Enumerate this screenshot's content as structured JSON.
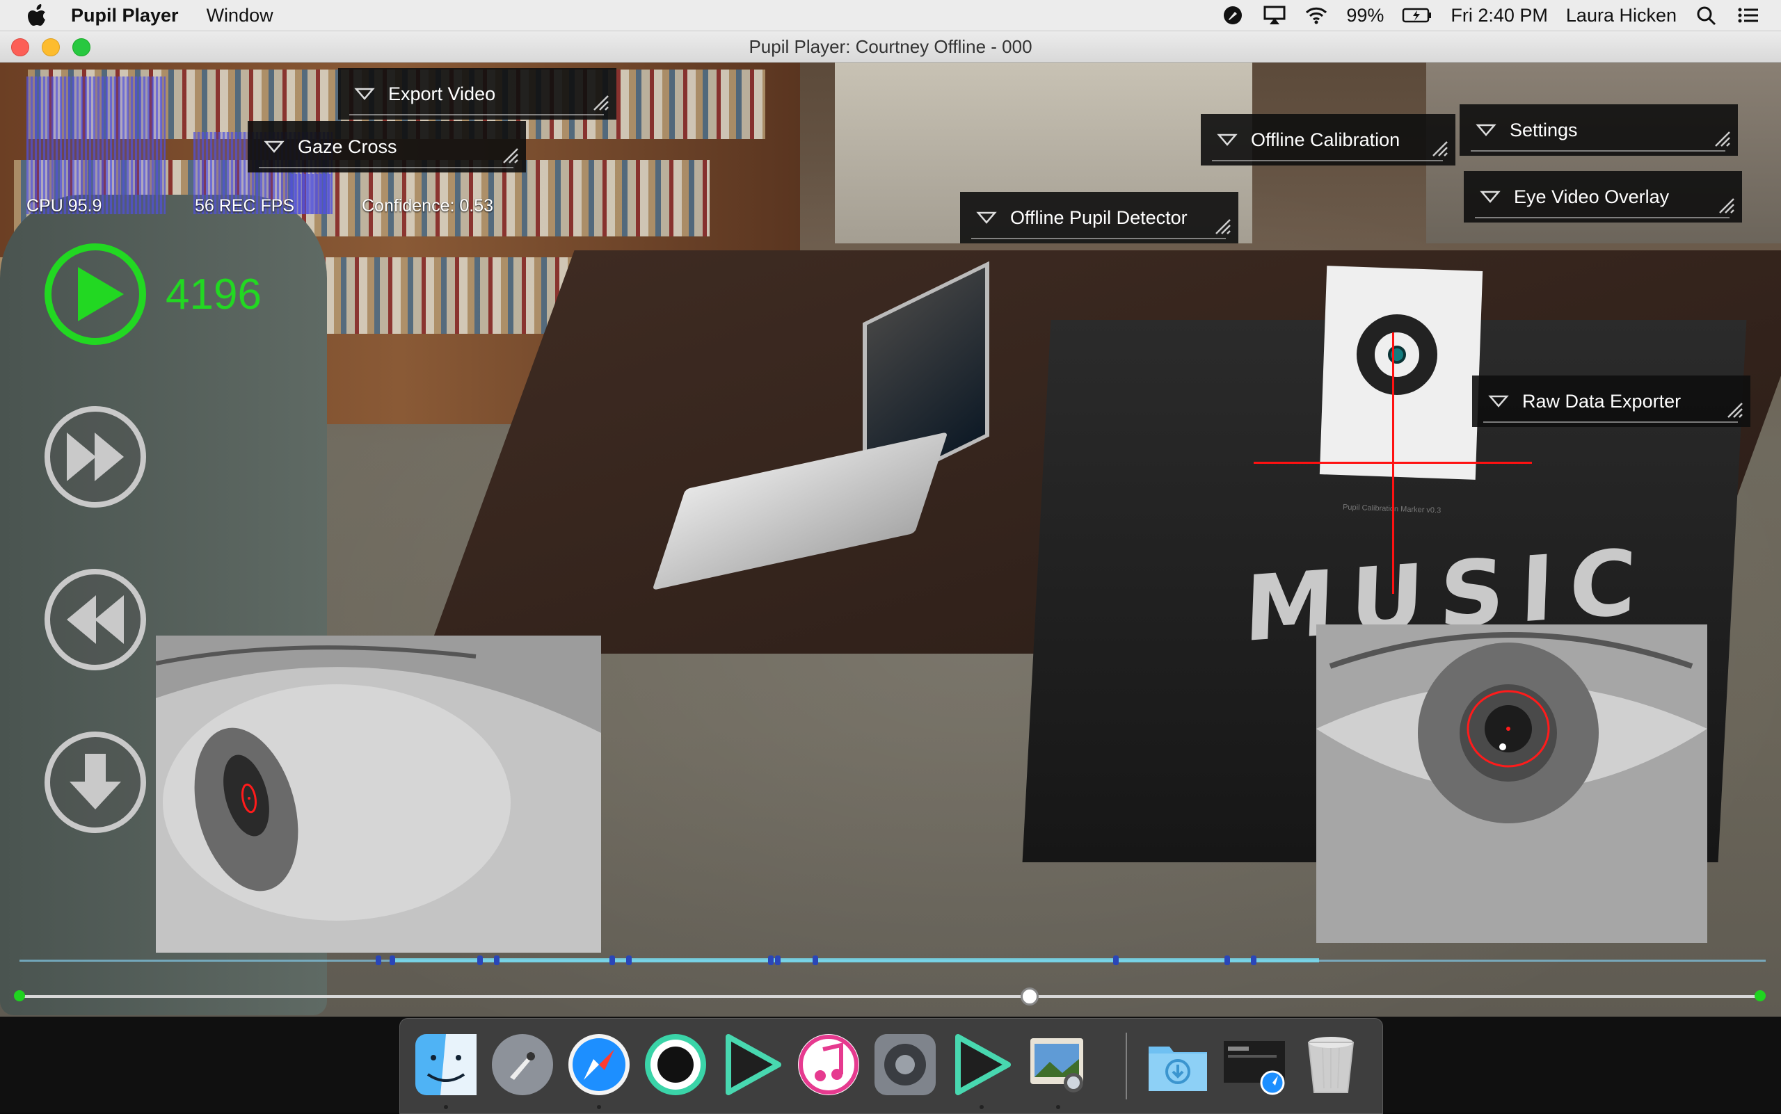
{
  "menubar": {
    "app_name": "Pupil Player",
    "menus": [
      "Window"
    ],
    "battery": "99%",
    "clock": "Fri 2:40 PM",
    "user": "Laura Hicken",
    "icons": [
      "apple-icon",
      "eyedropper-icon",
      "airplay-icon",
      "wifi-icon",
      "battery-icon",
      "spotlight-search-icon",
      "notification-center-icon"
    ]
  },
  "window": {
    "title": "Pupil Player: Courtney Offline - 000"
  },
  "hud": {
    "cpu": "CPU 95.9",
    "fps": "56 REC FPS",
    "confidence": "Confidence: 0.53",
    "frame_number": "4196",
    "play_color": "#22d822"
  },
  "plugin_menus": {
    "export_video": "Export Video",
    "gaze_cross": "Gaze Cross",
    "offline_calibration": "Offline Calibration",
    "settings": "Settings",
    "eye_video_overlay": "Eye Video Overlay",
    "offline_pupil_detector": "Offline Pupil Detector",
    "raw_data_exporter": "Raw Data Exporter"
  },
  "scene": {
    "marker_text": "Pupil Calibration Marker v0.3",
    "sign_text": "MUSIC"
  },
  "seek": {
    "progress": 0.58
  },
  "dock": {
    "apps": [
      "Finder",
      "Launchpad",
      "Safari",
      "Open Broadcaster",
      "Pupil Capture",
      "iTunes",
      "System Preferences",
      "Pupil Player",
      "Preview",
      "Downloads",
      "Screenshot Stack",
      "Trash"
    ]
  }
}
